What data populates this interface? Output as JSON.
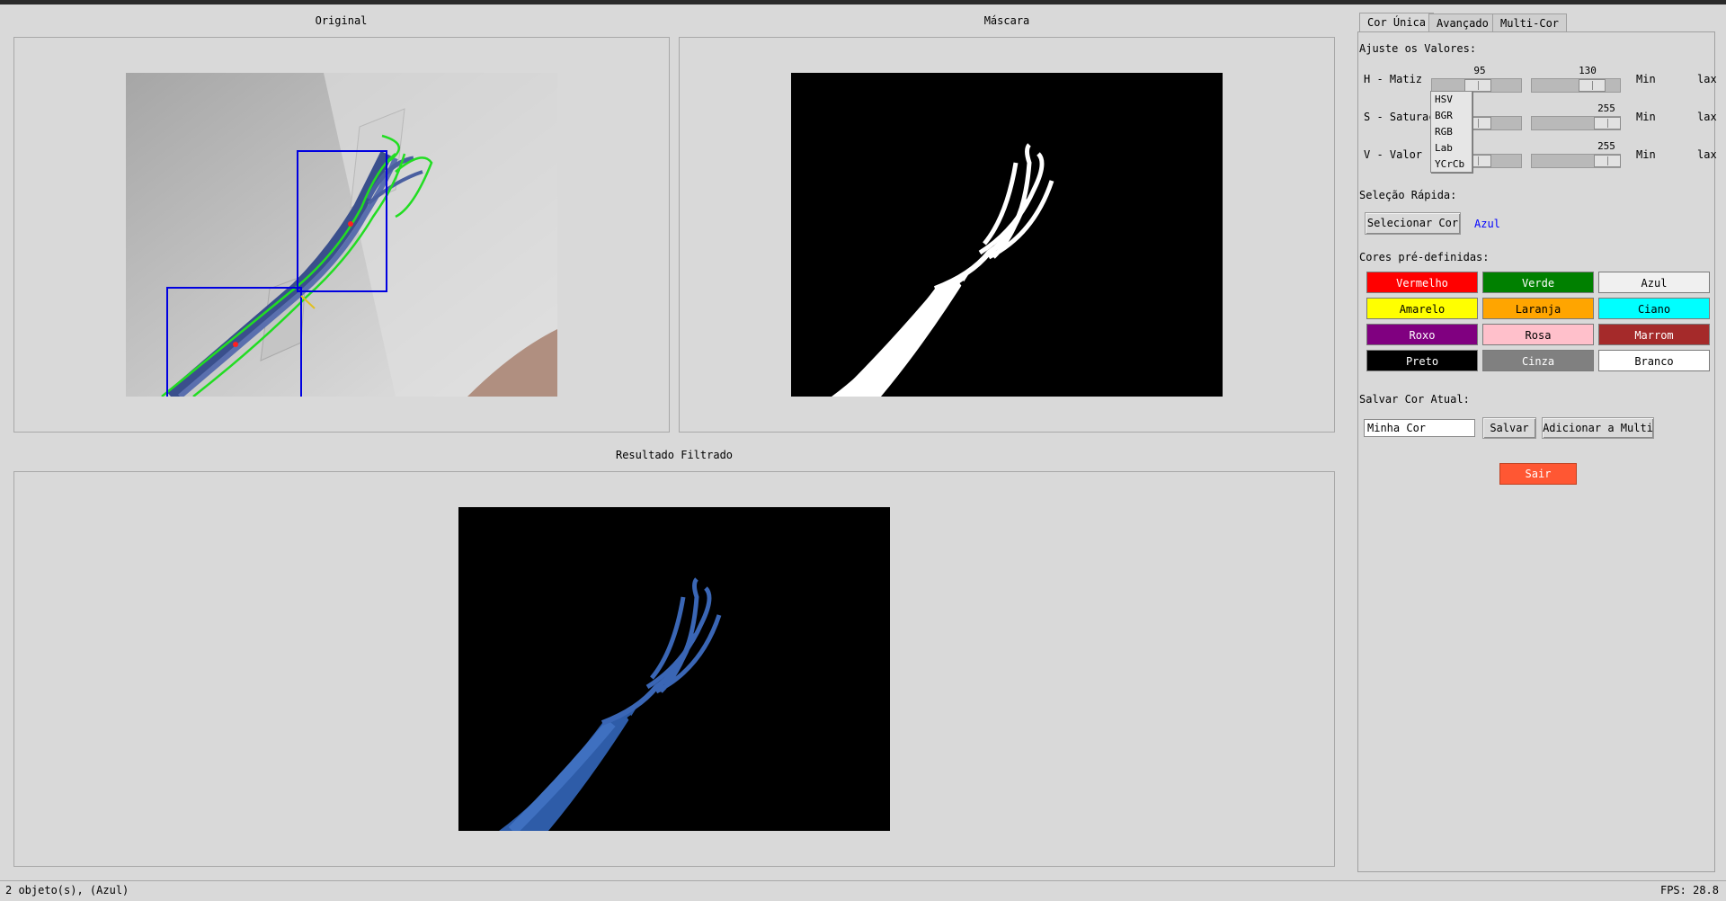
{
  "panels": {
    "original_title": "Original",
    "mask_title": "Máscara",
    "result_title": "Resultado Filtrado"
  },
  "tabs": [
    {
      "label": "Cor Única",
      "active": true
    },
    {
      "label": "Avançado",
      "active": false
    },
    {
      "label": "Multi-Cor",
      "active": false
    }
  ],
  "controls": {
    "section_adjust": "Ajuste os Valores:",
    "sliders": [
      {
        "label": "H - Matiz",
        "min_value": "95",
        "max_value": "130",
        "min_label": "Min",
        "max_label": "lax"
      },
      {
        "label": "S - Saturação",
        "min_value": "",
        "max_value": "255",
        "min_label": "Min",
        "max_label": "lax"
      },
      {
        "label": "V - Valor",
        "min_value": "",
        "max_value": "255",
        "min_label": "Min",
        "max_label": "lax"
      }
    ],
    "colorspace_options": [
      "HSV",
      "BGR",
      "RGB",
      "Lab",
      "YCrCb"
    ],
    "section_quick": "Seleção Rápida:",
    "select_color_button": "Selecionar Cor",
    "selected_color_name": "Azul",
    "section_presets": "Cores pré-definidas:",
    "presets": [
      {
        "label": "Vermelho",
        "bg": "#ff0000",
        "fg": "#ffffff"
      },
      {
        "label": "Verde",
        "bg": "#008000",
        "fg": "#ffffff"
      },
      {
        "label": "Azul",
        "bg": "#f0f0f0",
        "fg": "#000000"
      },
      {
        "label": "Amarelo",
        "bg": "#ffff00",
        "fg": "#000000"
      },
      {
        "label": "Laranja",
        "bg": "#ffa500",
        "fg": "#000000"
      },
      {
        "label": "Ciano",
        "bg": "#00ffff",
        "fg": "#000000"
      },
      {
        "label": "Roxo",
        "bg": "#800080",
        "fg": "#ffffff"
      },
      {
        "label": "Rosa",
        "bg": "#ffc0cb",
        "fg": "#000000"
      },
      {
        "label": "Marrom",
        "bg": "#a52a2a",
        "fg": "#ffffff"
      },
      {
        "label": "Preto",
        "bg": "#000000",
        "fg": "#ffffff"
      },
      {
        "label": "Cinza",
        "bg": "#808080",
        "fg": "#ffffff"
      },
      {
        "label": "Branco",
        "bg": "#ffffff",
        "fg": "#000000"
      }
    ],
    "section_save": "Salvar Cor Atual:",
    "save_name_value": "Minha Cor",
    "save_button": "Salvar",
    "add_multi_button": "Adicionar a Multi",
    "exit_button": "Sair",
    "exit_color": "#ff5733",
    "accent_blue": "#0000ff"
  },
  "status": {
    "left": "2 objeto(s), (Azul)",
    "right": "FPS: 28.8"
  }
}
